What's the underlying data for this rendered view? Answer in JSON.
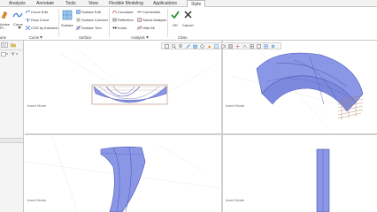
{
  "tabs": [
    {
      "label": "Analysis"
    },
    {
      "label": "Annotate"
    },
    {
      "label": "Tools"
    },
    {
      "label": "View"
    },
    {
      "label": "Flexible Modeling"
    },
    {
      "label": "Applications"
    },
    {
      "label": "Style",
      "active": true
    }
  ],
  "ribbon": {
    "left_big_label_1": "Active",
    "left_big_label_2": "Pl...",
    "curve_big_label": "Curve",
    "curve_items": [
      "Curve Edit",
      "Drop Curve",
      "COS by Intersect"
    ],
    "surface_big_label": "Surface",
    "surface_items": [
      "Surface Edit",
      "Surface Connect",
      "Surface Trim"
    ],
    "analysis_items": [
      "Curvature",
      "Reflection",
      "Knots"
    ],
    "analysis_items_2": [
      "Connection",
      "Saved Analysis",
      "Hide All"
    ],
    "ok_label": "OK",
    "cancel_label": "Cancel",
    "groups": {
      "left": "ane",
      "curve": "Curve",
      "surface": "Surface",
      "analysis": "Analysis",
      "close": "Close"
    }
  },
  "viewports": {
    "top_left_label": "Insert Mode",
    "top_right_label": "Insert Mode",
    "bottom_left_label": "Insert Mode",
    "bottom_right_label": "Insert Mode"
  },
  "colors": {
    "surface_blue": "#8a96e6",
    "surface_dark": "#4a55b0",
    "ok_green": "#2e8b3a",
    "cancel_dark": "#333333"
  }
}
